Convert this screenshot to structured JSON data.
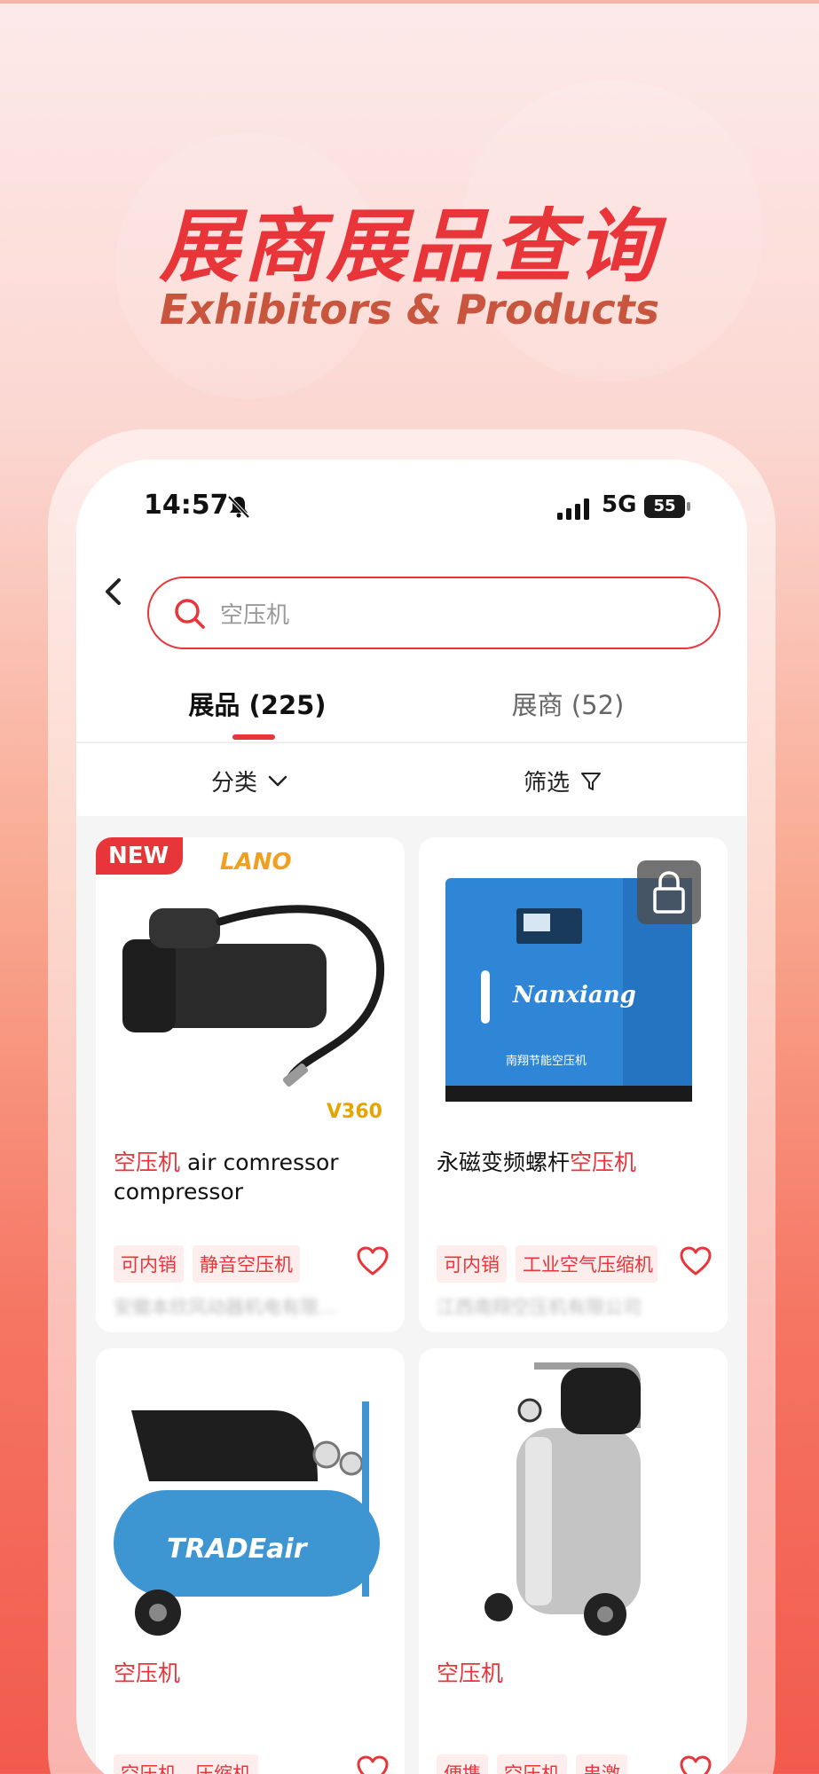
{
  "hero": {
    "title": "展商展品查询",
    "subtitle": "Exhibitors & Products"
  },
  "status_bar": {
    "time": "14:57",
    "network": "5G",
    "battery": "55"
  },
  "search": {
    "value": "空压机"
  },
  "tabs": [
    {
      "label": "展品 (225)",
      "active": true
    },
    {
      "label": "展商 (52)",
      "active": false
    }
  ],
  "filters": {
    "category": "分类",
    "screen": "筛选"
  },
  "products": [
    {
      "badge": "NEW",
      "brand_text": "LANO",
      "model_text": "V360",
      "title_highlight": "空压机",
      "title_rest": " air comressor compressor",
      "tags": [
        "可内销",
        "静音空压机"
      ],
      "company": "安徽本欣风动器机电有限..."
    },
    {
      "title_prefix": "永磁变频螺杆",
      "title_highlight": "空压机",
      "machine_brand": "Nanxiang",
      "machine_label": "南翔节能空压机",
      "tags": [
        "可内销",
        "工业空气压缩机"
      ],
      "company": "江西南翔空压机有限公司"
    },
    {
      "title_highlight": "空压机",
      "machine_brand": "TRADEair",
      "tags": [
        "空压机，压缩机"
      ]
    },
    {
      "title_highlight": "空压机",
      "tags": [
        "便携",
        "空压机",
        "串激"
      ]
    }
  ],
  "colors": {
    "accent": "#e8353a",
    "tag_bg": "#fdeeed",
    "screen_bg": "#f5f5f5"
  }
}
